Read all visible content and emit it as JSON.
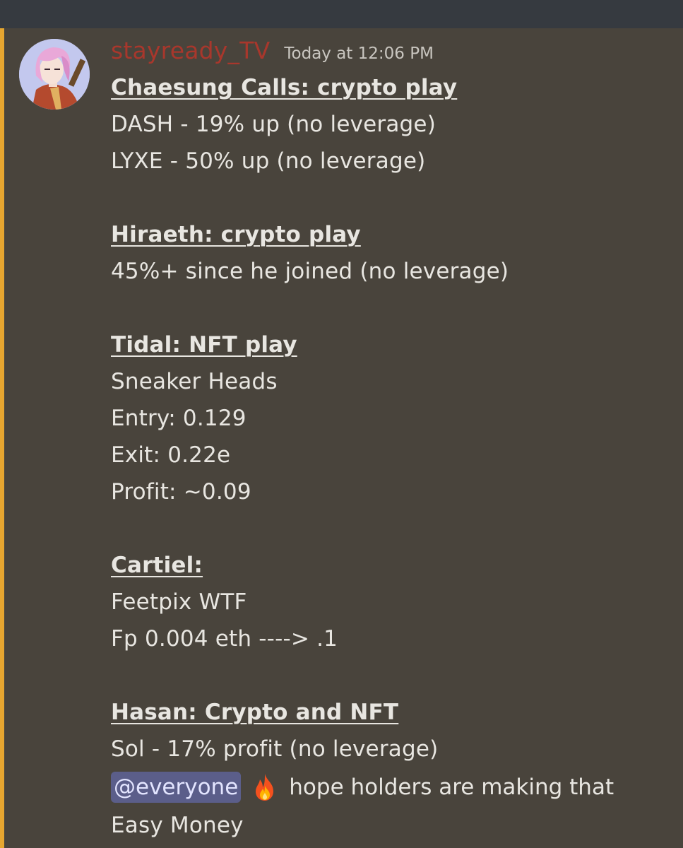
{
  "message": {
    "author": "stayready_TV",
    "timestamp": "Today at 12:06 PM",
    "colors": {
      "author": "#a8372c",
      "mention_bg": "#5b5e8a",
      "mention_stripe": "#e6a630",
      "background": "#49443c"
    },
    "sections": [
      {
        "heading": "Chaesung Calls:  crypto play",
        "lines": [
          "DASH - 19% up (no leverage)",
          "LYXE - 50% up (no leverage)"
        ]
      },
      {
        "heading": "Hiraeth: crypto play",
        "lines": [
          "45%+ since he joined (no leverage)"
        ]
      },
      {
        "heading": "Tidal: NFT play",
        "lines": [
          "Sneaker Heads",
          "Entry: 0.129",
          "Exit: 0.22e",
          "Profit: ~0.09"
        ]
      },
      {
        "heading": "Cartiel:",
        "lines": [
          "Feetpix WTF",
          "Fp 0.004 eth ----> .1"
        ]
      },
      {
        "heading": "Hasan: Crypto and NFT",
        "lines": [
          "Sol - 17% profit (no leverage)"
        ]
      }
    ],
    "mention": "@everyone",
    "emoji": "fire-emoji",
    "closing_line_1": "hope holders are making that",
    "closing_line_2": "Easy Money"
  }
}
